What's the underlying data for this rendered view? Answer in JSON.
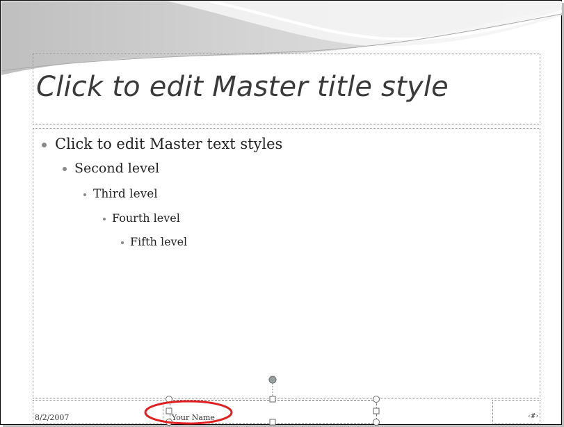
{
  "slide": {
    "title_placeholder": "Click to edit Master title style",
    "body_levels": [
      "Click to edit Master text styles",
      "Second level",
      "Third level",
      "Fourth level",
      "Fifth level"
    ]
  },
  "footer": {
    "date": "8/2/2007",
    "name": "Your Name",
    "slide_number": "‹#›"
  },
  "colors": {
    "highlight_circle": "#e02020",
    "placeholder_border": "#8c8c8c",
    "handle_fill": "#ffffff",
    "rotation_handle": "#9aa0a0"
  }
}
